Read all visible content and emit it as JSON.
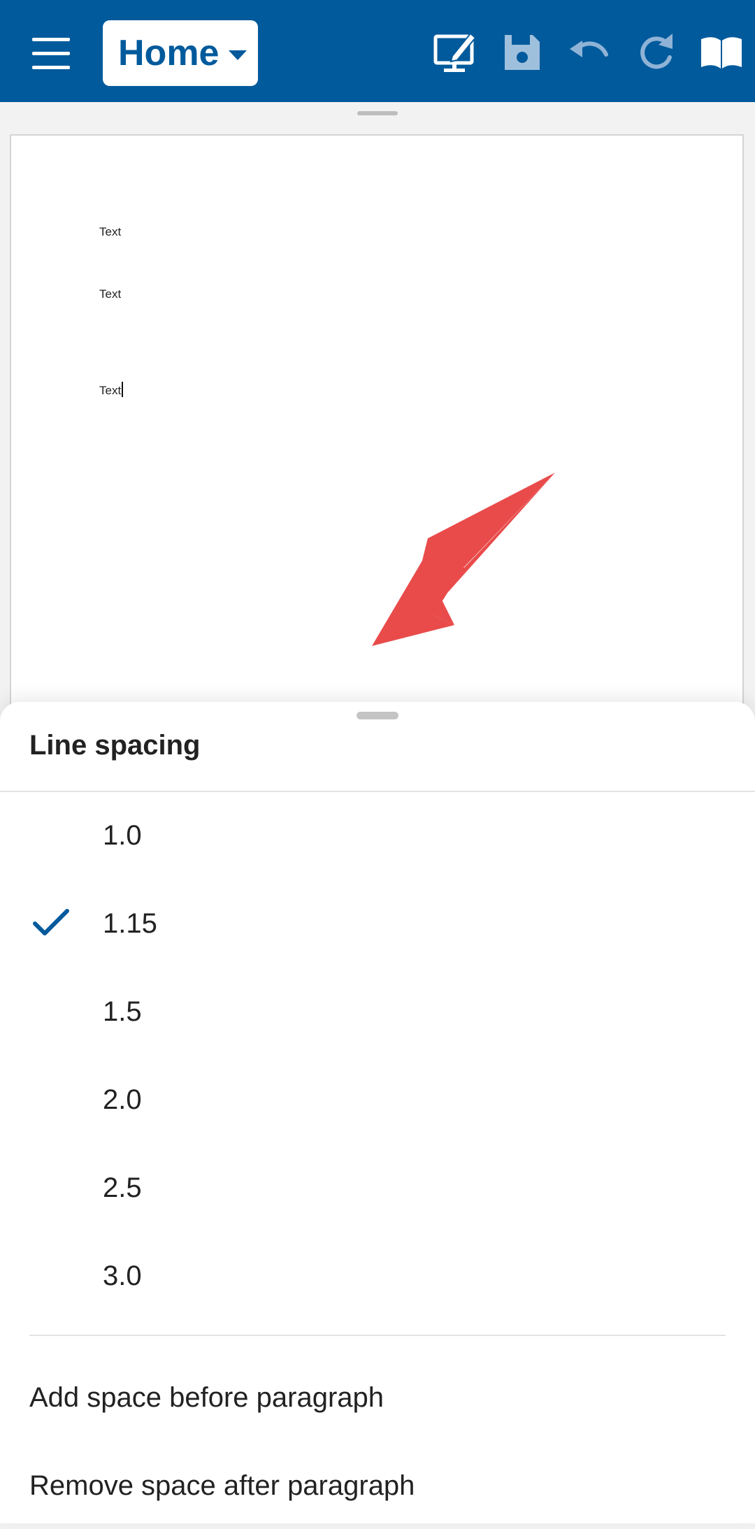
{
  "toolbar": {
    "view_label": "Home",
    "bg_color": "#005a9c",
    "icons": [
      "menu-icon",
      "presentation-edit-icon",
      "save-icon",
      "undo-icon",
      "redo-icon",
      "read-mode-icon"
    ]
  },
  "document": {
    "lines": [
      "Text",
      "Text",
      "Text"
    ]
  },
  "annotation": {
    "arrow_color": "#e94b4b"
  },
  "sheet": {
    "title": "Line spacing",
    "options": [
      {
        "label": "1.0",
        "selected": false
      },
      {
        "label": "1.15",
        "selected": true
      },
      {
        "label": "1.5",
        "selected": false
      },
      {
        "label": "2.0",
        "selected": false
      },
      {
        "label": "2.5",
        "selected": false
      },
      {
        "label": "3.0",
        "selected": false
      }
    ],
    "actions": [
      {
        "label": "Add space before paragraph"
      },
      {
        "label": "Remove space after paragraph"
      }
    ],
    "check_color": "#005a9c"
  }
}
